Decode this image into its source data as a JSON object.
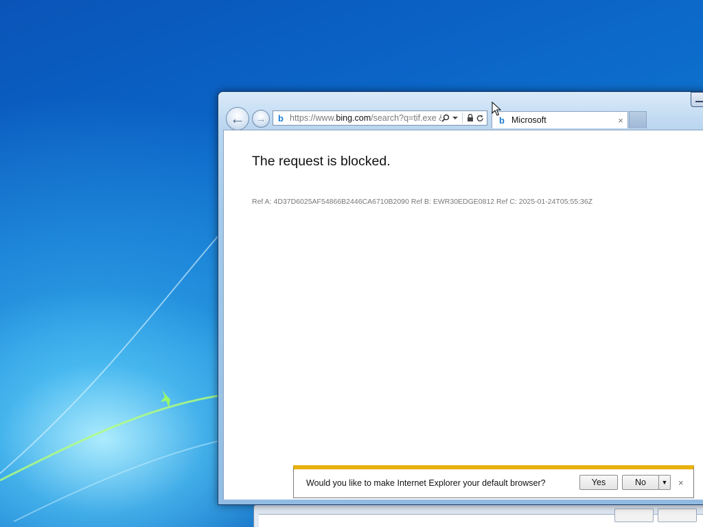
{
  "browser": {
    "back_glyph": "←",
    "forward_glyph": "→",
    "address": {
      "scheme": "https://www.",
      "host": "bing.com",
      "path": "/search?q=tif.exe &",
      "icons": [
        "search-icon",
        "dropdown-icon",
        "lock-icon",
        "refresh-icon"
      ]
    },
    "tab": {
      "title": "Microsoft",
      "close_glyph": "×"
    },
    "favicon_glyph": "b"
  },
  "page": {
    "headline": "The request is blocked.",
    "ref_line": "Ref A: 4D37D6025AF54866B2446CA6710B2090 Ref B: EWR30EDGE0812 Ref C: 2025-01-24T05:55:36Z"
  },
  "notification": {
    "message": "Would you like to make Internet Explorer your default browser?",
    "yes_label": "Yes",
    "no_label": "No",
    "dropdown_glyph": "▼",
    "close_glyph": "×",
    "accent_color": "#e8b10b"
  }
}
